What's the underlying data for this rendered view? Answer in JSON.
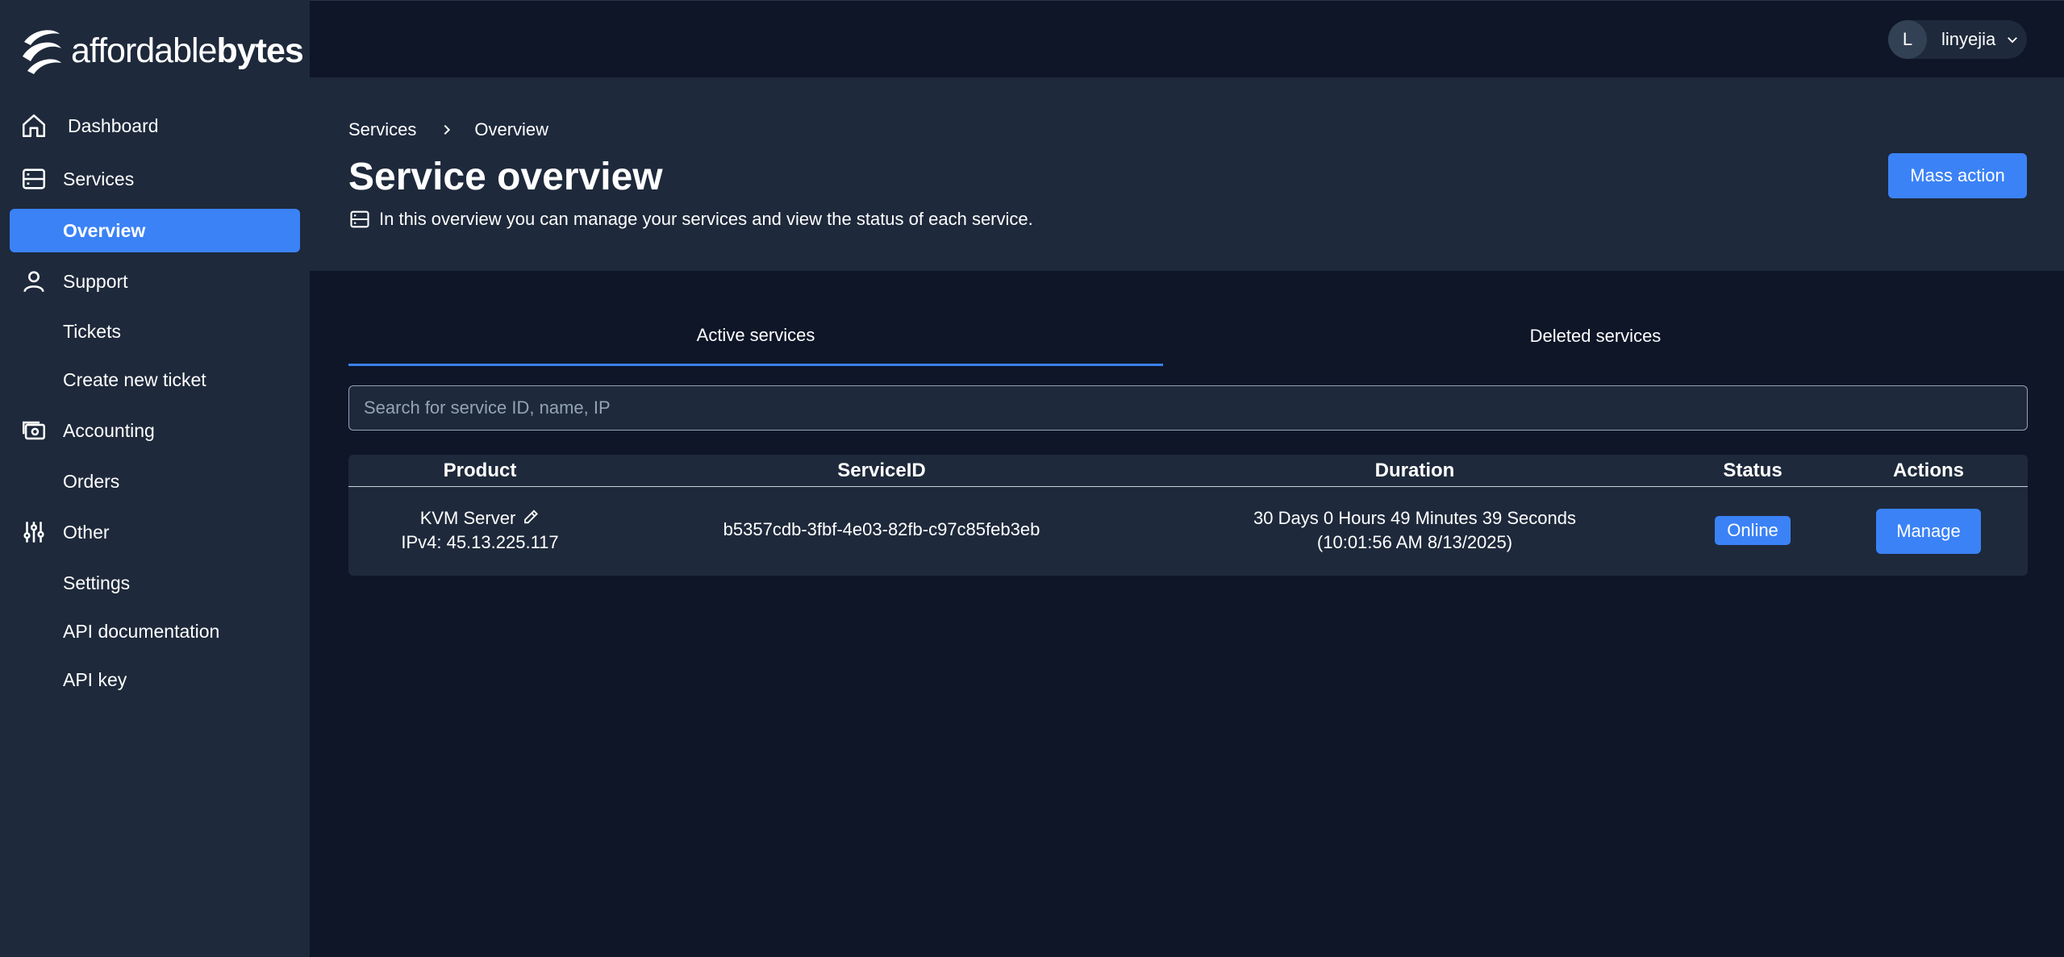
{
  "brand": {
    "light": "affordable",
    "bold": "bytes"
  },
  "sidebar": {
    "items": [
      {
        "label": "Dashboard",
        "icon": "home-icon"
      },
      {
        "label": "Services",
        "icon": "server-icon"
      },
      {
        "label": "Overview",
        "active": true
      },
      {
        "label": "Support",
        "icon": "user-icon"
      },
      {
        "label": "Tickets"
      },
      {
        "label": "Create new ticket"
      },
      {
        "label": "Accounting",
        "icon": "money-icon"
      },
      {
        "label": "Orders"
      },
      {
        "label": "Other",
        "icon": "sliders-icon"
      },
      {
        "label": "Settings"
      },
      {
        "label": "API documentation"
      },
      {
        "label": "API key"
      }
    ]
  },
  "user": {
    "initial": "L",
    "name": "linyejia"
  },
  "breadcrumb": {
    "parent": "Services",
    "current": "Overview"
  },
  "header": {
    "title": "Service overview",
    "subtitle": "In this overview you can manage your services and view the status of each service.",
    "mass_action_label": "Mass action"
  },
  "tabs": [
    {
      "label": "Active services",
      "active": true
    },
    {
      "label": "Deleted services",
      "active": false
    }
  ],
  "search": {
    "placeholder": "Search for service ID, name, IP",
    "value": ""
  },
  "table": {
    "columns": [
      "Product",
      "ServiceID",
      "Duration",
      "Status",
      "Actions"
    ],
    "rows": [
      {
        "product_name": "KVM Server",
        "product_ip": "IPv4: 45.13.225.117",
        "service_id": "b5357cdb-3fbf-4e03-82fb-c97c85feb3eb",
        "duration": "30 Days 0 Hours 49 Minutes 39 Seconds",
        "since": "(10:01:56 AM 8/13/2025)",
        "status": "Online",
        "action_label": "Manage"
      }
    ]
  },
  "colors": {
    "accent": "#3b82f6",
    "sidebar": "#1e293b",
    "background": "#0e1628"
  }
}
